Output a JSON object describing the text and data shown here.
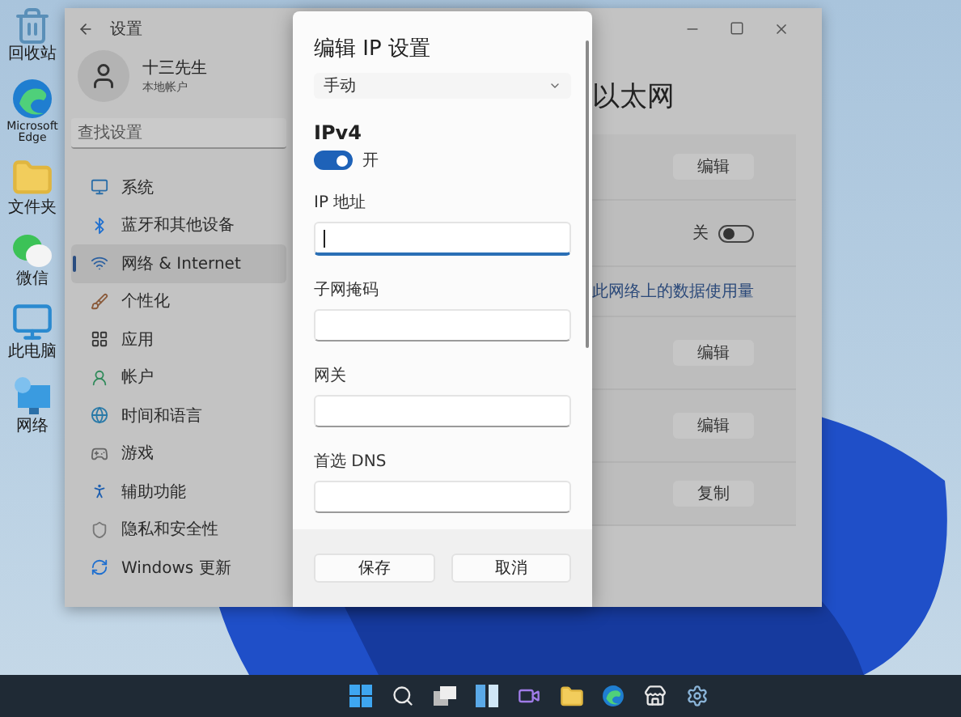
{
  "desktop_icons": [
    {
      "kind": "recycle",
      "label": "回收站"
    },
    {
      "kind": "edge",
      "label": "Microsoft Edge"
    },
    {
      "kind": "folder",
      "label": "文件夹"
    },
    {
      "kind": "chat",
      "label": "微信"
    },
    {
      "kind": "pc",
      "label": "此电脑"
    },
    {
      "kind": "network",
      "label": "网络"
    }
  ],
  "settings_window": {
    "title": "设置",
    "profile": {
      "name": "十三先生",
      "account": "本地帐户"
    },
    "search": {
      "placeholder": "查找设置"
    },
    "nav_items": [
      {
        "label": "系统",
        "selected": false
      },
      {
        "label": "蓝牙和其他设备",
        "selected": false
      },
      {
        "label": "网络 & Internet",
        "selected": true
      },
      {
        "label": "个性化",
        "selected": false
      },
      {
        "label": "应用",
        "selected": false
      },
      {
        "label": "帐户",
        "selected": false
      },
      {
        "label": "时间和语言",
        "selected": false
      },
      {
        "label": "游戏",
        "selected": false
      },
      {
        "label": "辅助功能",
        "selected": false
      },
      {
        "label": "隐私和安全性",
        "selected": false
      },
      {
        "label": "Windows 更新",
        "selected": false
      }
    ],
    "heading": "以太网",
    "rows": [
      {
        "kind": "button",
        "label": "编辑"
      },
      {
        "kind": "toggle",
        "label": "关",
        "on": false
      },
      {
        "kind": "link",
        "label": "此网络上的数据使用量"
      },
      {
        "kind": "button",
        "label": "编辑"
      },
      {
        "kind": "button",
        "label": "编辑"
      },
      {
        "kind": "button",
        "label": "复制"
      }
    ]
  },
  "dialog": {
    "title": "编辑 IP 设置",
    "mode_dropdown": {
      "value": "手动"
    },
    "section": "IPv4",
    "ipv4_toggle": {
      "on": true,
      "label": "开"
    },
    "fields": [
      {
        "label": "IP 地址",
        "focused": true
      },
      {
        "label": "子网掩码",
        "focused": false
      },
      {
        "label": "网关",
        "focused": false
      },
      {
        "label": "首选 DNS",
        "focused": false
      }
    ],
    "buttons": [
      {
        "label": "保存"
      },
      {
        "label": "取消"
      }
    ]
  }
}
